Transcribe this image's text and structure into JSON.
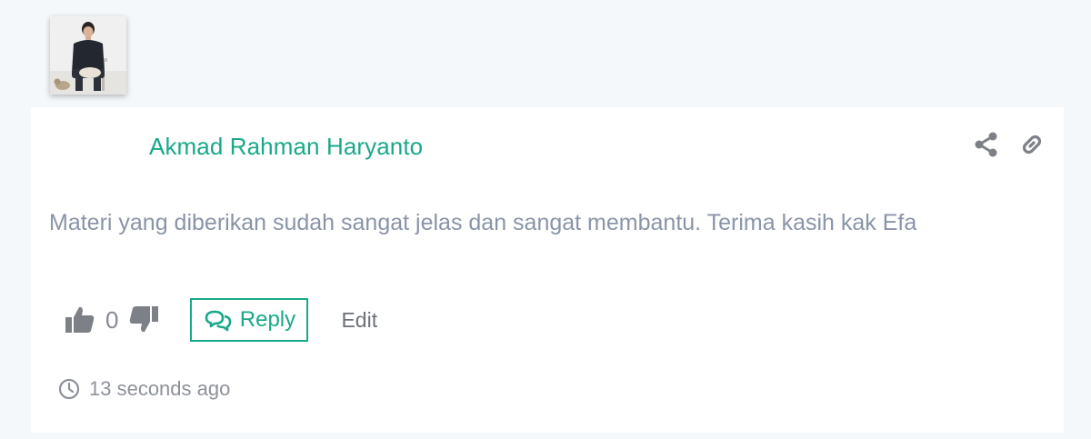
{
  "comment": {
    "author_name": "Akmad Rahman Haryanto",
    "text": "Materi yang diberikan sudah sangat jelas dan sangat membantu. Terima kasih kak Efa",
    "vote_count": "0",
    "reply_label": "Reply",
    "edit_label": "Edit",
    "timestamp": "13 seconds ago"
  },
  "icons": {
    "share": "share-icon",
    "link": "link-icon",
    "upvote": "thumbs-up-icon",
    "downvote": "thumbs-down-icon",
    "reply": "comments-icon",
    "time": "clock-icon"
  },
  "colors": {
    "accent": "#19a98a",
    "text_muted": "#8a94a8",
    "icon_gray": "#7d8087"
  }
}
